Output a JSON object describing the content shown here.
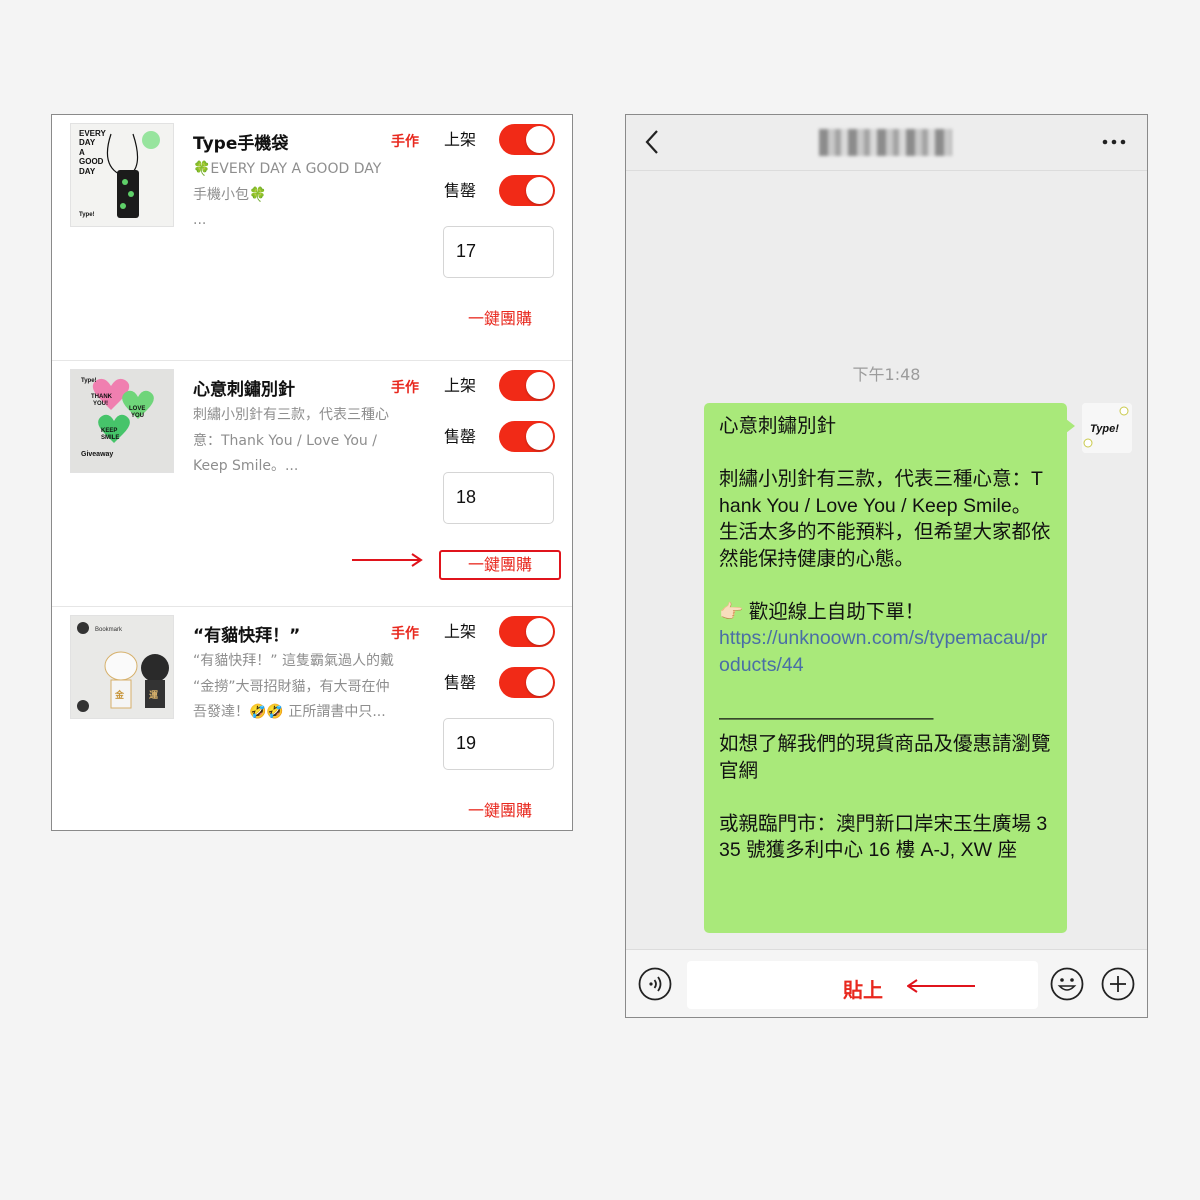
{
  "products": [
    {
      "name": "Type手機袋",
      "tag": "手作",
      "description": "🍀EVERY DAY A GOOD DAY\n手機小包🍀\n...",
      "listed_label": "上架",
      "soldout_label": "售罄",
      "quantity": "17",
      "buy_label": "一鍵團購",
      "thumb_text": [
        "EVERY",
        "DAY",
        "A",
        "GOOD",
        "DAY"
      ],
      "thumb_brand": "Type!"
    },
    {
      "name": "心意刺鏽別針",
      "tag": "手作",
      "description": "刺繡小別針有三款，代表三種心\n意：Thank You / Love You /\nKeep Smile。...",
      "listed_label": "上架",
      "soldout_label": "售罄",
      "quantity": "18",
      "buy_label": "一鍵團購",
      "thumb_text": [
        "THANK",
        "YOU!",
        "LOVE",
        "YOU",
        "KEEP",
        "SMILE",
        "Giveaway"
      ],
      "thumb_brand": "Type!"
    },
    {
      "name": "“有貓快拜！”",
      "tag": "手作",
      "description": "“有貓快拜！” 這隻霸氣過人的戴\n“金撈”大哥招財貓，有大哥在仲\n吾發達！🤣🤣 正所謂書中只...",
      "listed_label": "上架",
      "soldout_label": "售罄",
      "quantity": "19",
      "buy_label": "一鍵團購",
      "thumb_text": [
        "Bookmark",
        "金",
        "運"
      ],
      "thumb_brand": ""
    }
  ],
  "chat": {
    "timestamp": "下午1:48",
    "message_lines": [
      "心意刺鏽別針",
      "",
      "刺繡小別針有三款，代表三種心意：Thank You / Love You / Keep Smile。",
      "生活太多的不能預料，但希望大家都依然能保持健康的心態。",
      "",
      "👉🏻 歡迎線上自助下單！",
      "https://unknoown.com/s/typemacau/products/44",
      "",
      "———————————",
      "如想了解我們的現貨商品及優惠請瀏覽官網",
      "",
      "或親臨門市：澳門新口岸宋玉生廣場 335 號獲多利中心 16 樓 A-J, XW 座"
    ],
    "avatar_text": "Type!",
    "paste_label": "貼上"
  },
  "colors": {
    "accent_red": "#e8281e",
    "toggle_on": "#f12a17",
    "bubble_green": "#a9e97a",
    "link_blue": "#4a6ea6"
  },
  "icons": {
    "back": "chevron-left-icon",
    "more": "more-dots-icon",
    "voice": "voice-icon",
    "emoji": "emoji-icon",
    "plus": "plus-icon"
  }
}
